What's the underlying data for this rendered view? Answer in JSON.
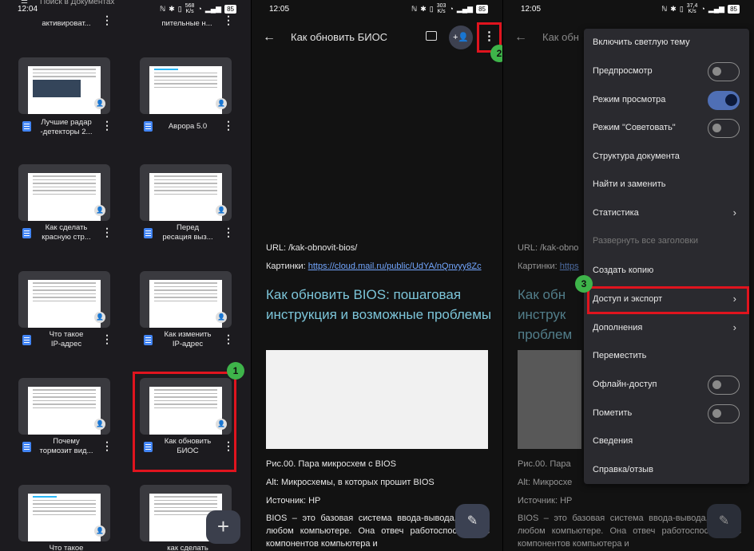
{
  "panel1": {
    "status_time": "12:04",
    "status_speed": "568",
    "status_speed_unit": "K/s",
    "battery": "85",
    "search_hint": "Поиск в Документах",
    "top_titles": [
      "активироват...",
      "пительные н..."
    ],
    "docs": [
      {
        "line1": "Лучшие радар",
        "line2": "-детекторы 2..."
      },
      {
        "line1": "Аврора 5.0",
        "line2": ""
      },
      {
        "line1": "Как сделать",
        "line2": "красную стр..."
      },
      {
        "line1": "Перед",
        "line2": "ресация выз..."
      },
      {
        "line1": "Что такое",
        "line2": "IP-адрес"
      },
      {
        "line1": "Как изменить",
        "line2": "IP-адрес"
      },
      {
        "line1": "Почему",
        "line2": "тормозит вид..."
      },
      {
        "line1": "Как обновить",
        "line2": "БИОС"
      },
      {
        "line1": "Что такое",
        "line2": ""
      },
      {
        "line1": "как сделать",
        "line2": ""
      }
    ],
    "fab_label": "+",
    "badge": "1"
  },
  "panel2": {
    "status_time": "12:05",
    "status_speed": "303",
    "status_speed_unit": "K/s",
    "battery": "85",
    "title": "Как обновить БИОС",
    "badge": "2",
    "url_line": "URL: /kak-obnovit-bios/",
    "pics_label": "Картинки: ",
    "pics_link": "https://cloud.mail.ru/public/UdYA/nQnvyy8Zc",
    "heading": "Как обновить BIOS: пошаговая инструкция и возможные проблемы",
    "caption": "Рис.00. Пара микросхем с BIOS",
    "alt": "Alt: Микросхемы, в которых прошит BIOS",
    "source": "Источник: HP",
    "para": "BIOS – это базовая система ввода-вывода, есть в любом компьютере. Она отвеч работоспособность компонентов компьютера и"
  },
  "panel3": {
    "status_time": "12:05",
    "status_speed": "37,4",
    "status_speed_unit": "K/s",
    "battery": "85",
    "title": "Как обн",
    "url_line": "URL: /kak-obno",
    "pics_label": "Картинки: ",
    "pics_link": "https",
    "heading": "Как обн инструк проблем",
    "caption": "Рис.00. Пара",
    "alt": "Alt: Микросхе",
    "source": "Источник: HP",
    "para": "BIOS – это базовая система ввода-вывода, есть в любом компьютере. Она отвеч работоспособность компонентов компьютера и",
    "badge": "3",
    "menu": [
      {
        "label": "Включить светлую тему"
      },
      {
        "label": "Предпросмотр"
      },
      {
        "label": "Режим просмотра"
      },
      {
        "label": "Режим \"Советовать\""
      },
      {
        "label": "Структура документа"
      },
      {
        "label": "Найти и заменить"
      },
      {
        "label": "Статистика"
      },
      {
        "label": "Развернуть все заголовки"
      },
      {
        "label": "Создать копию"
      },
      {
        "label": "Доступ и экспорт"
      },
      {
        "label": "Дополнения"
      },
      {
        "label": "Переместить"
      },
      {
        "label": "Офлайн-доступ"
      },
      {
        "label": "Пометить"
      },
      {
        "label": "Сведения"
      },
      {
        "label": "Справка/отзыв"
      }
    ],
    "toggles": {
      "preview": false,
      "view_mode": true,
      "suggest_mode": false,
      "offline": false,
      "star": false
    }
  },
  "colors": {
    "accent_red": "#e0141e",
    "badge_green": "#3eb44a",
    "heading_teal": "#7cc5d9",
    "link_blue": "#73a7ff",
    "toggle_on": "#4f6fb5"
  }
}
